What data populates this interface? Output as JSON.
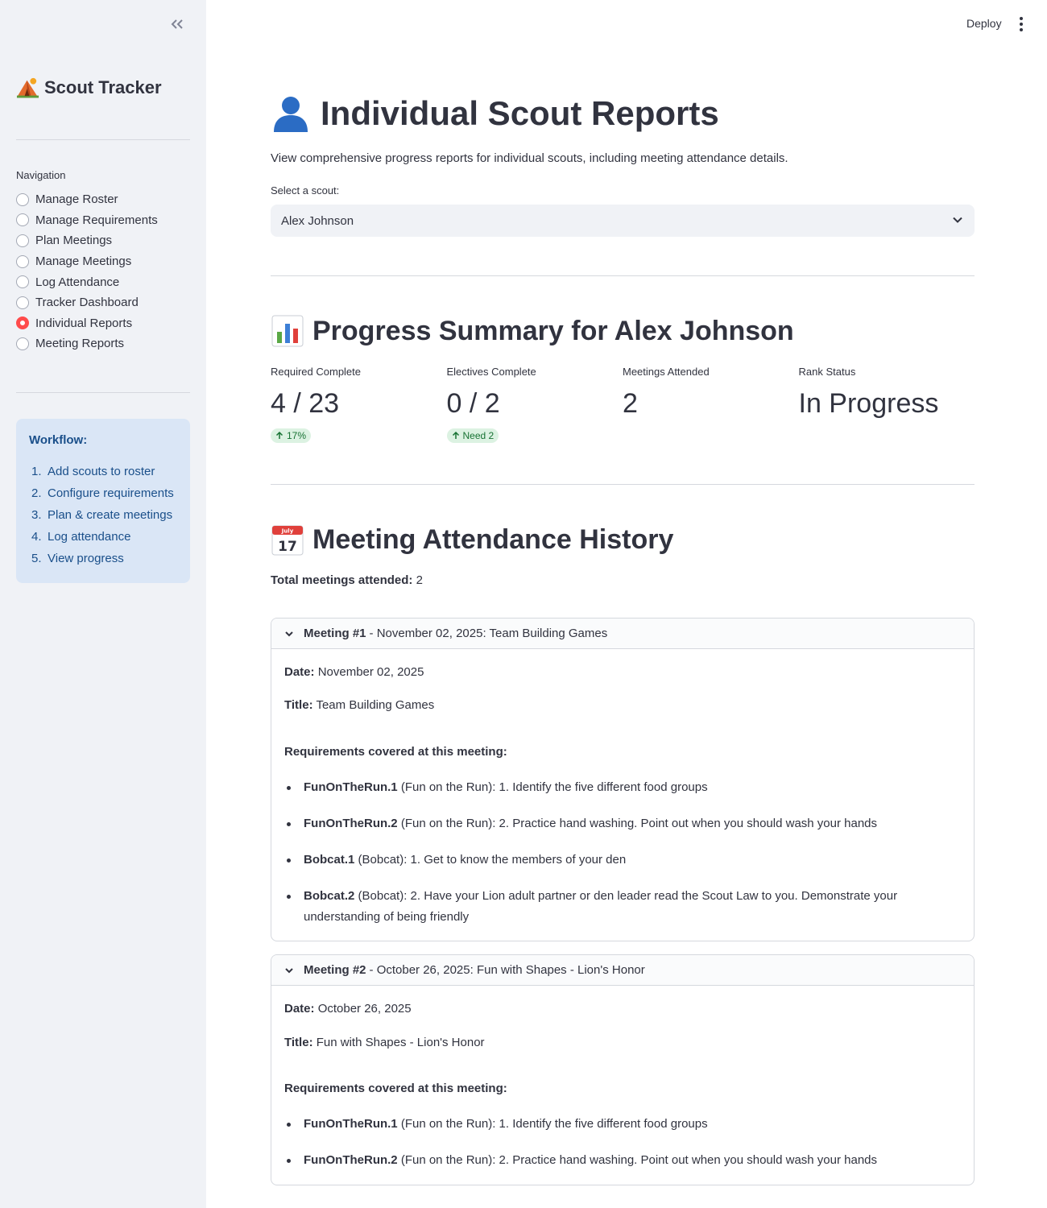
{
  "sidebar": {
    "app_title": "Scout Tracker",
    "nav_label": "Navigation",
    "nav_items": [
      {
        "label": "Manage Roster",
        "selected": false
      },
      {
        "label": "Manage Requirements",
        "selected": false
      },
      {
        "label": "Plan Meetings",
        "selected": false
      },
      {
        "label": "Manage Meetings",
        "selected": false
      },
      {
        "label": "Log Attendance",
        "selected": false
      },
      {
        "label": "Tracker Dashboard",
        "selected": false
      },
      {
        "label": "Individual Reports",
        "selected": true
      },
      {
        "label": "Meeting Reports",
        "selected": false
      }
    ],
    "workflow": {
      "title": "Workflow:",
      "steps": [
        {
          "num": "1.",
          "text": "Add scouts to roster"
        },
        {
          "num": "2.",
          "text": "Configure requirements"
        },
        {
          "num": "3.",
          "text": "Plan & create meetings"
        },
        {
          "num": "4.",
          "text": "Log attendance"
        },
        {
          "num": "5.",
          "text": "View progress"
        }
      ]
    }
  },
  "header": {
    "deploy_label": "Deploy"
  },
  "page": {
    "title": "Individual Scout Reports",
    "intro": "View comprehensive progress reports for individual scouts, including meeting attendance details.",
    "select_label": "Select a scout:",
    "selected_scout": "Alex Johnson"
  },
  "summary": {
    "heading": "Progress Summary for Alex Johnson",
    "metrics": [
      {
        "label": "Required Complete",
        "value": "4 / 23",
        "delta": "17%"
      },
      {
        "label": "Electives Complete",
        "value": "0 / 2",
        "delta": "Need 2"
      },
      {
        "label": "Meetings Attended",
        "value": "2",
        "delta": null
      },
      {
        "label": "Rank Status",
        "value": "In Progress",
        "delta": null
      }
    ]
  },
  "history": {
    "heading": "Meeting Attendance History",
    "total_label": "Total meetings attended:",
    "total_value": "2",
    "meetings": [
      {
        "header_bold": "Meeting #1",
        "header_rest": "- November 02, 2025: Team Building Games",
        "date_label": "Date:",
        "date": "November 02, 2025",
        "title_label": "Title:",
        "title": "Team Building Games",
        "req_heading": "Requirements covered at this meeting:",
        "requirements": [
          {
            "code": "FunOnTheRun.1",
            "text": "(Fun on the Run): 1. Identify the five different food groups"
          },
          {
            "code": "FunOnTheRun.2",
            "text": "(Fun on the Run): 2. Practice hand washing. Point out when you should wash your hands"
          },
          {
            "code": "Bobcat.1",
            "text": "(Bobcat): 1. Get to know the members of your den"
          },
          {
            "code": "Bobcat.2",
            "text": "(Bobcat): 2. Have your Lion adult partner or den leader read the Scout Law to you. Demonstrate your understanding of being friendly"
          }
        ]
      },
      {
        "header_bold": "Meeting #2",
        "header_rest": "- October 26, 2025: Fun with Shapes - Lion's Honor",
        "date_label": "Date:",
        "date": "October 26, 2025",
        "title_label": "Title:",
        "title": "Fun with Shapes - Lion's Honor",
        "req_heading": "Requirements covered at this meeting:",
        "requirements": [
          {
            "code": "FunOnTheRun.1",
            "text": "(Fun on the Run): 1. Identify the five different food groups"
          },
          {
            "code": "FunOnTheRun.2",
            "text": "(Fun on the Run): 2. Practice hand washing. Point out when you should wash your hands"
          }
        ]
      }
    ]
  },
  "colors": {
    "accent": "#ff4b4b",
    "sidebar_bg": "#f0f2f6",
    "info_bg": "#dae6f6",
    "info_text": "#1a4f8a",
    "delta_bg": "#dcf2e2",
    "delta_text": "#177233"
  },
  "icons": {
    "collapse": "double-chevron-left-icon",
    "app": "camping-tent-icon",
    "title": "bust-silhouette-icon",
    "summary": "bar-chart-icon",
    "history": "calendar-icon",
    "menu": "kebab-menu-icon"
  }
}
